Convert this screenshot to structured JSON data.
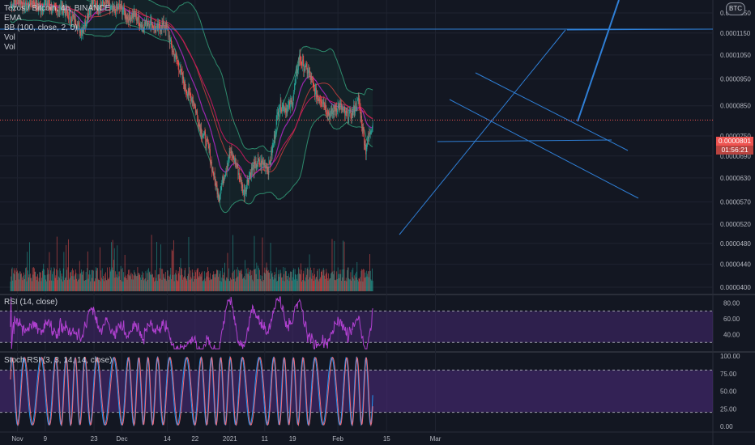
{
  "header": {
    "title": "Tezos / Bitcoin, 4h, BINANCE",
    "indicators": [
      "EMA",
      "BB (100, close, 2, 0)",
      "Vol",
      "Vol"
    ],
    "currency_badge": "BTC"
  },
  "price_panel": {
    "y_ticks": [
      "0.0001250",
      "0.0001150",
      "0.0001050",
      "0.0000950",
      "0.0000850",
      "0.0000801",
      "0.0000750",
      "0.0000690",
      "0.0000630",
      "0.0000570",
      "0.0000520",
      "0.0000480",
      "0.0000440",
      "0.0000400"
    ],
    "current_price": "0.0000801",
    "countdown": "01:56:21"
  },
  "rsi_panel": {
    "label": "RSI (14, close)",
    "y_ticks": [
      "80.00",
      "60.00",
      "40.00"
    ]
  },
  "stoch_panel": {
    "label": "Stoch RSI (3, 3, 14, 14, close)",
    "y_ticks": [
      "100.00",
      "75.00",
      "50.00",
      "25.00",
      "0.00"
    ]
  },
  "x_axis": {
    "ticks": [
      "Nov",
      "9",
      "23",
      "Dec",
      "14",
      "22",
      "2021",
      "11",
      "19",
      "Feb",
      "15",
      "Mar"
    ]
  },
  "colors": {
    "background": "#131722",
    "up": "#26a69a",
    "down": "#ef5350",
    "ema": "#9c27b0",
    "bb_basis": "#b03a3a",
    "bb_band": "#2e8b6d",
    "trendline": "#2f7fd6",
    "rsi": "#9c27b0",
    "stoch_k": "#2196f3",
    "stoch_d": "#ef6c7a"
  },
  "chart_data": {
    "type": "candlestick",
    "symbol": "Tezos / Bitcoin",
    "interval": "4h",
    "exchange": "BINANCE",
    "x_range": [
      "Oct 27 2020",
      "Mar 10 2021"
    ],
    "y_range": [
      4e-05,
      0.00013
    ],
    "close_trajectory": [
      {
        "date": "Oct 30",
        "close": 0.000131
      },
      {
        "date": "Nov 9",
        "close": 0.000129
      },
      {
        "date": "Nov 16",
        "close": 0.000125
      },
      {
        "date": "Nov 19",
        "close": 0.000116
      },
      {
        "date": "Nov 23",
        "close": 0.000131
      },
      {
        "date": "Dec 1",
        "close": 0.000126
      },
      {
        "date": "Dec 7",
        "close": 0.00012
      },
      {
        "date": "Dec 14",
        "close": 0.000117
      },
      {
        "date": "Dec 17",
        "close": 0.0001
      },
      {
        "date": "Dec 22",
        "close": 8.4e-05
      },
      {
        "date": "Dec 26",
        "close": 7e-05
      },
      {
        "date": "Dec 29",
        "close": 5.8e-05
      },
      {
        "date": "Jan 1",
        "close": 7.1e-05
      },
      {
        "date": "Jan 5",
        "close": 6e-05
      },
      {
        "date": "Jan 9",
        "close": 6.8e-05
      },
      {
        "date": "Jan 12",
        "close": 6.5e-05
      },
      {
        "date": "Jan 15",
        "close": 8.4e-05
      },
      {
        "date": "Jan 19",
        "close": 8.6e-05
      },
      {
        "date": "Jan 21",
        "close": 0.000105
      },
      {
        "date": "Jan 25",
        "close": 9.2e-05
      },
      {
        "date": "Jan 29",
        "close": 8.3e-05
      },
      {
        "date": "Feb 2",
        "close": 8.4e-05
      },
      {
        "date": "Feb 5",
        "close": 8.1e-05
      },
      {
        "date": "Feb 7",
        "close": 8.8e-05
      },
      {
        "date": "Feb 9",
        "close": 7e-05
      },
      {
        "date": "Feb 11",
        "close": 8.01e-05
      }
    ],
    "indicators": {
      "rsi": {
        "upper": 70,
        "lower": 30
      },
      "stoch_rsi": {
        "upper": 80,
        "lower": 20
      }
    }
  }
}
